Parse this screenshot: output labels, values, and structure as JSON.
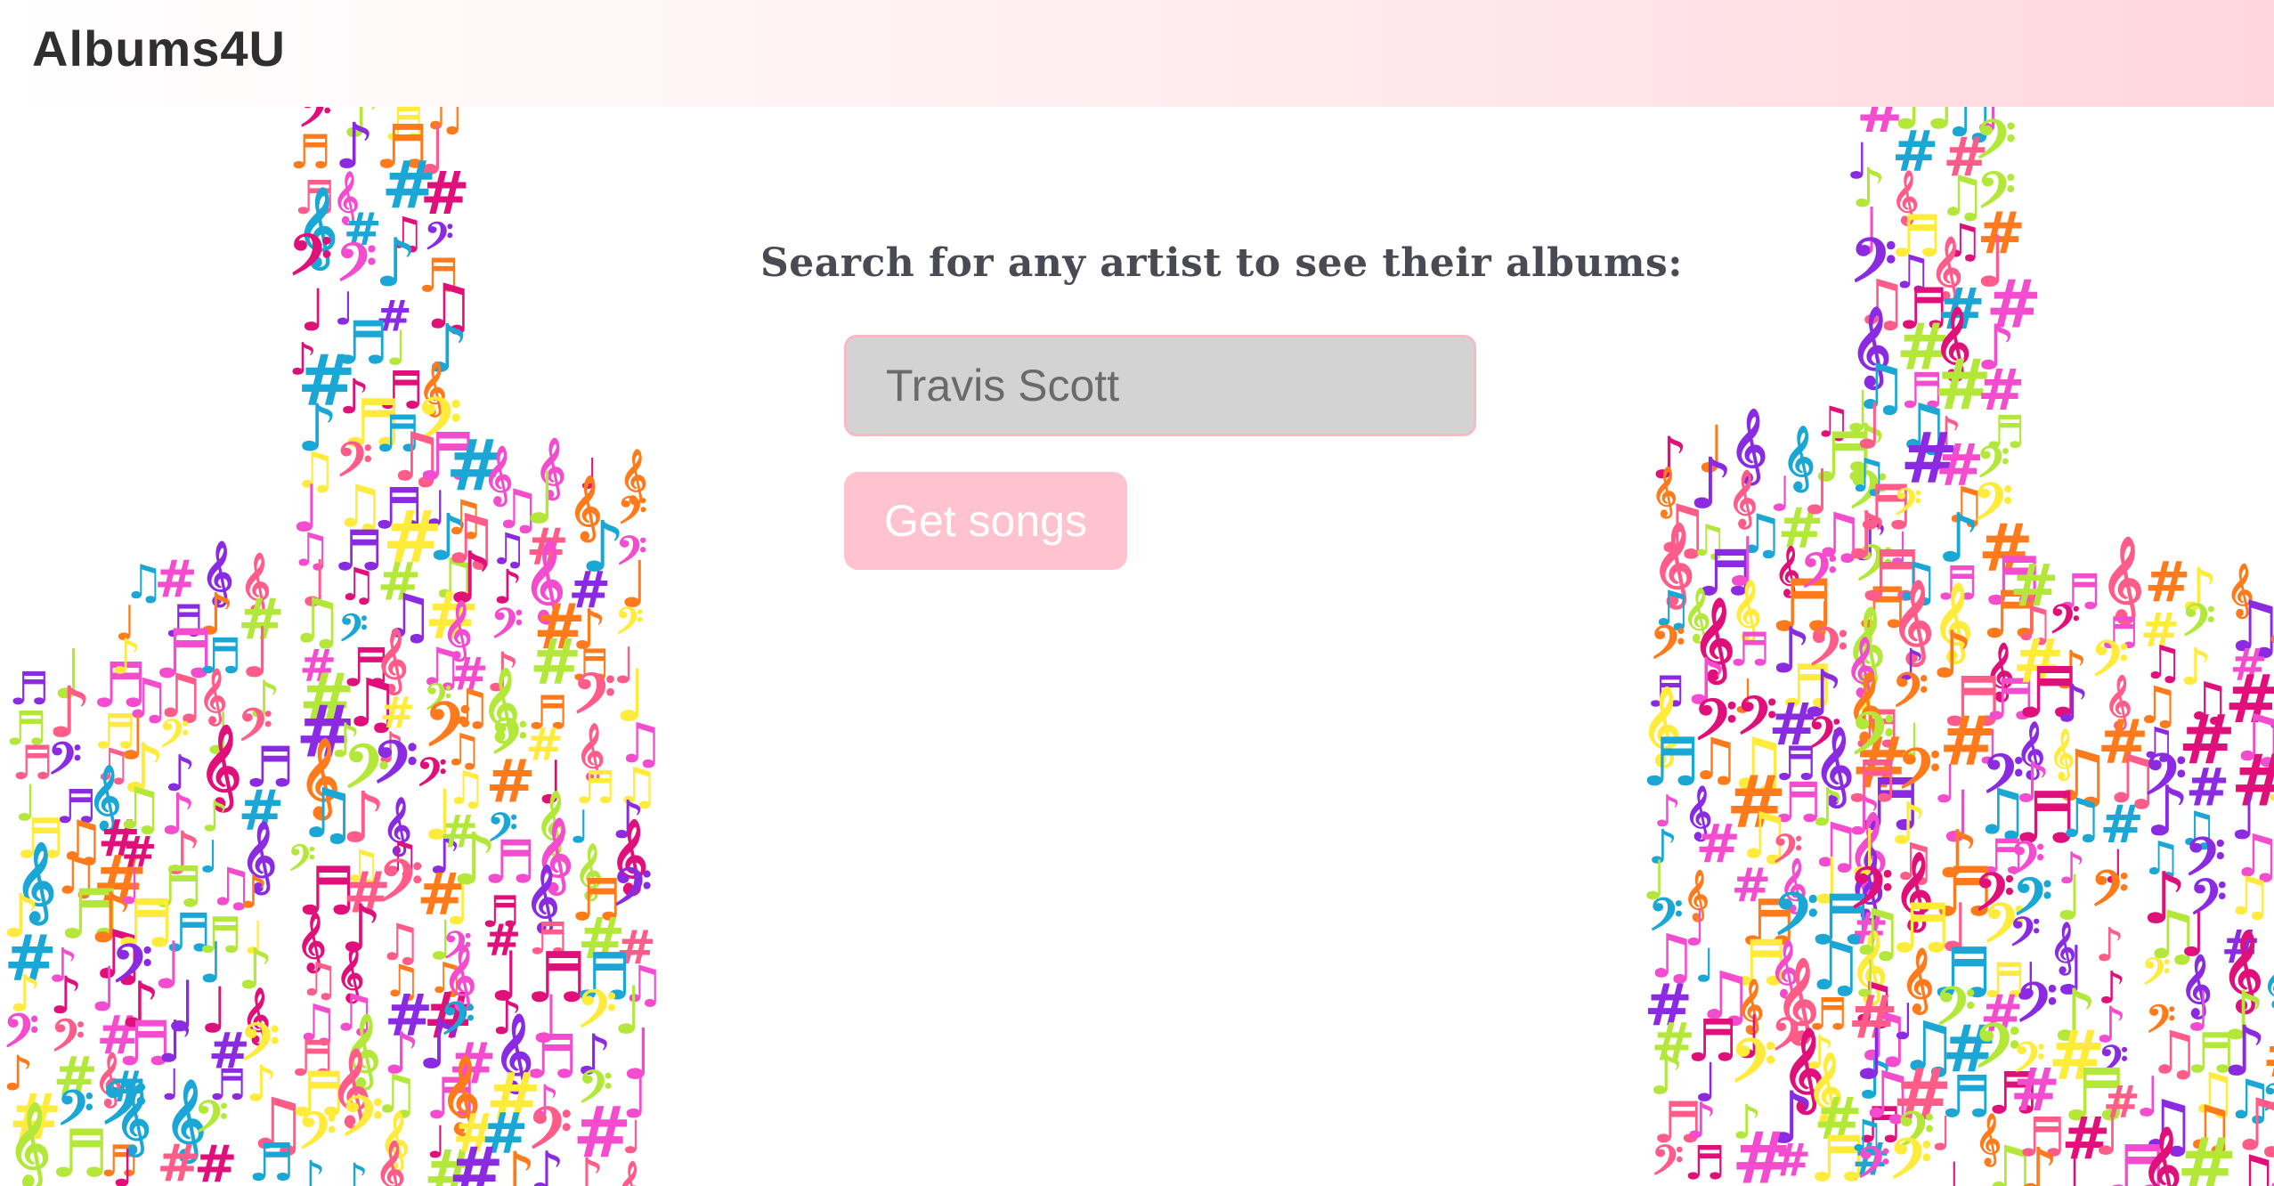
{
  "app": {
    "title": "Albums4U"
  },
  "search": {
    "prompt": "Search for any artist to see their albums:",
    "value": "Travis Scott",
    "placeholder": "Travis Scott",
    "button_label": "Get songs"
  },
  "decor": {
    "icon": "music-notes-illustration",
    "palette": [
      "#f44ccf",
      "#8a2be2",
      "#ff7a1a",
      "#ffeb3b",
      "#b3e83b",
      "#1aa7d6",
      "#e0107a",
      "#ff5c8a"
    ],
    "glyphs": [
      "♪",
      "♫",
      "♩",
      "♬",
      "𝄞",
      "𝄢",
      "#"
    ]
  },
  "colors": {
    "accent": "#ffc2cf",
    "input_border": "#f7b9c6",
    "input_bg": "#d3d3d3",
    "header_gradient_end": "#ffd6dd"
  }
}
